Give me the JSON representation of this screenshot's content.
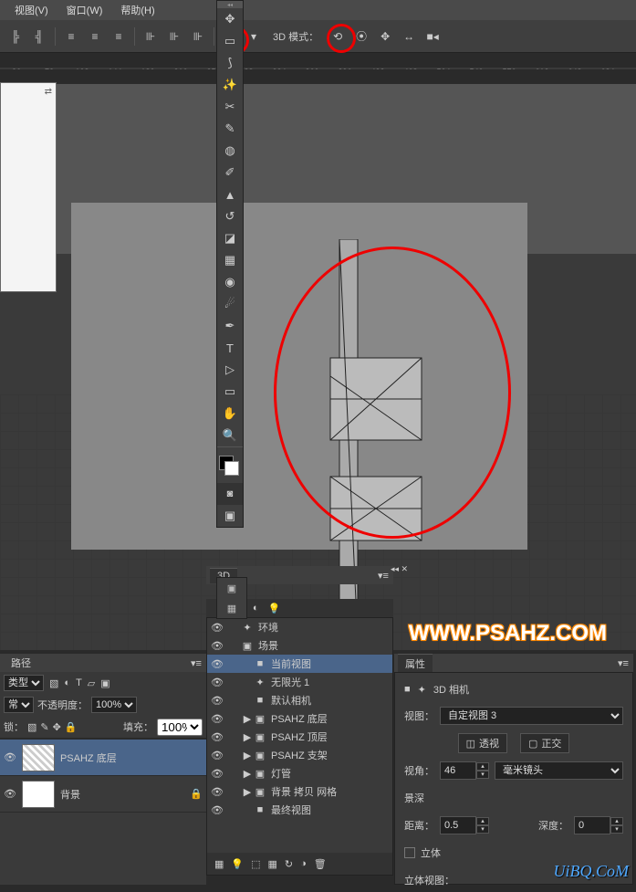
{
  "menu": {
    "view_d": "视图(V)",
    "window": "窗口(W)",
    "help": "帮助(H)"
  },
  "options_bar": {
    "mode_label": "3D 模式："
  },
  "ruler_ticks": [
    "36",
    "72",
    "108",
    "144",
    "180",
    "216",
    "252",
    "288",
    "324",
    "360",
    "396",
    "432",
    "468",
    "504",
    "540",
    "576",
    "612",
    "648",
    "684"
  ],
  "panel3d": {
    "tab": "3D",
    "items": [
      {
        "indent": 0,
        "icon": "✦",
        "label": "环境",
        "eye": true
      },
      {
        "indent": 0,
        "icon": "▣",
        "label": "场景",
        "eye": true
      },
      {
        "indent": 1,
        "icon": "■",
        "label": "当前视图",
        "eye": true,
        "sel": true
      },
      {
        "indent": 1,
        "icon": "✦",
        "label": "无限光 1",
        "eye": true
      },
      {
        "indent": 1,
        "icon": "■",
        "label": "默认相机",
        "eye": true
      },
      {
        "indent": 1,
        "twisty": "▶",
        "icon": "▣",
        "label": "PSAHZ 底层",
        "eye": true
      },
      {
        "indent": 1,
        "twisty": "▶",
        "icon": "▣",
        "label": "PSAHZ 顶层",
        "eye": true
      },
      {
        "indent": 1,
        "twisty": "▶",
        "icon": "▣",
        "label": "PSAHZ 支架",
        "eye": true
      },
      {
        "indent": 1,
        "twisty": "▶",
        "icon": "▣",
        "label": "灯管",
        "eye": true
      },
      {
        "indent": 1,
        "twisty": "▶",
        "icon": "▣",
        "label": "背景 拷贝 网格",
        "eye": true
      },
      {
        "indent": 1,
        "icon": "■",
        "label": "最终视图",
        "eye": true
      }
    ]
  },
  "props": {
    "tab": "属性",
    "camera_title": "3D 相机",
    "view_label": "视图：",
    "view_value": "自定视图 3",
    "perspective": "透视",
    "ortho": "正交",
    "fov_label": "视角：",
    "fov_value": "46",
    "lens_value": "毫米镜头",
    "dof": "景深",
    "distance_label": "距离：",
    "distance_value": "0.5",
    "depth_label": "深度：",
    "depth_value": "0",
    "solid": "立体",
    "stereo_label": "立体视图："
  },
  "layers": {
    "tab_paths": "路径",
    "kind_label": "类型",
    "blend_mode": "常",
    "opacity_label": "不透明度：",
    "opacity_value": "100%",
    "lock_label": "锁：",
    "fill_label": "填充：",
    "fill_value": "100%",
    "rows": [
      {
        "name": "PSAHZ 底层",
        "sel": true
      },
      {
        "name": "背景",
        "lock": true
      }
    ]
  },
  "watermark1": "WWW.PSAHZ.COM",
  "watermark2": "UiBQ.CoM"
}
